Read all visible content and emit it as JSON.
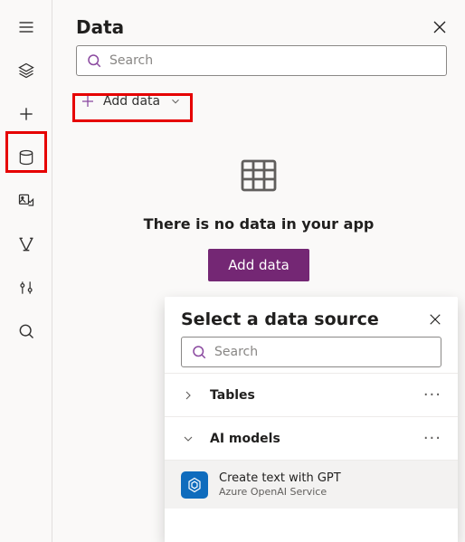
{
  "panel": {
    "title": "Data",
    "search_placeholder": "Search",
    "add_data_link": "Add data",
    "empty_msg": "There is no data in your app",
    "add_button": "Add data"
  },
  "rail": {
    "items": [
      {
        "name": "hamburger-icon"
      },
      {
        "name": "layers-icon"
      },
      {
        "name": "plus-icon"
      },
      {
        "name": "data-icon"
      },
      {
        "name": "media-icon"
      },
      {
        "name": "variables-icon"
      },
      {
        "name": "tools-icon"
      },
      {
        "name": "search-icon"
      }
    ]
  },
  "popup": {
    "title": "Select a data source",
    "search_placeholder": "Search",
    "sources": [
      {
        "label": "Tables",
        "expanded": false
      },
      {
        "label": "AI models",
        "expanded": true
      }
    ],
    "results": [
      {
        "title": "Create text with GPT",
        "subtitle": "Azure OpenAI Service"
      }
    ]
  },
  "colors": {
    "accent": "#742774",
    "iconAccent": "#8b4aa0"
  }
}
